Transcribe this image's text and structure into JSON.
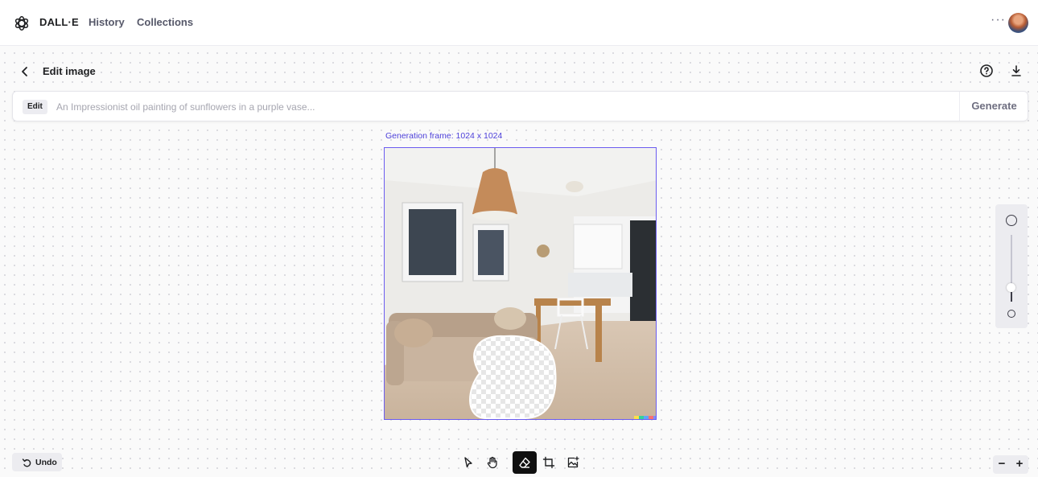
{
  "nav": {
    "brand": "DALL·E",
    "links": [
      "History",
      "Collections"
    ],
    "more": "···"
  },
  "header": {
    "title": "Edit image"
  },
  "prompt": {
    "badge": "Edit",
    "placeholder": "An Impressionist oil painting of sunflowers in a purple vase...",
    "value": "",
    "generate_label": "Generate"
  },
  "canvas": {
    "frame_label": "Generation frame: 1024 x 1024",
    "image_description": "Living room with beige sofa, pendant lamp, framed wall art and white kitchen; circular erased area on floor",
    "zoom_level": 0.15
  },
  "toolbar": {
    "undo_label": "Undo",
    "tools": [
      {
        "name": "select-tool",
        "icon": "pointer-icon",
        "active": false
      },
      {
        "name": "pan-tool",
        "icon": "hand-icon",
        "active": false
      },
      {
        "name": "eraser-tool",
        "icon": "eraser-icon",
        "active": true
      },
      {
        "name": "add-frame-tool",
        "icon": "frame-icon",
        "active": false
      },
      {
        "name": "upload-image-tool",
        "icon": "image-plus-icon",
        "active": false
      }
    ],
    "zoom_out": "−",
    "zoom_in": "+"
  },
  "colors": {
    "accent": "#6b5cf0",
    "frame_label": "#4c3fd9",
    "active_tool_bg": "#101010"
  }
}
